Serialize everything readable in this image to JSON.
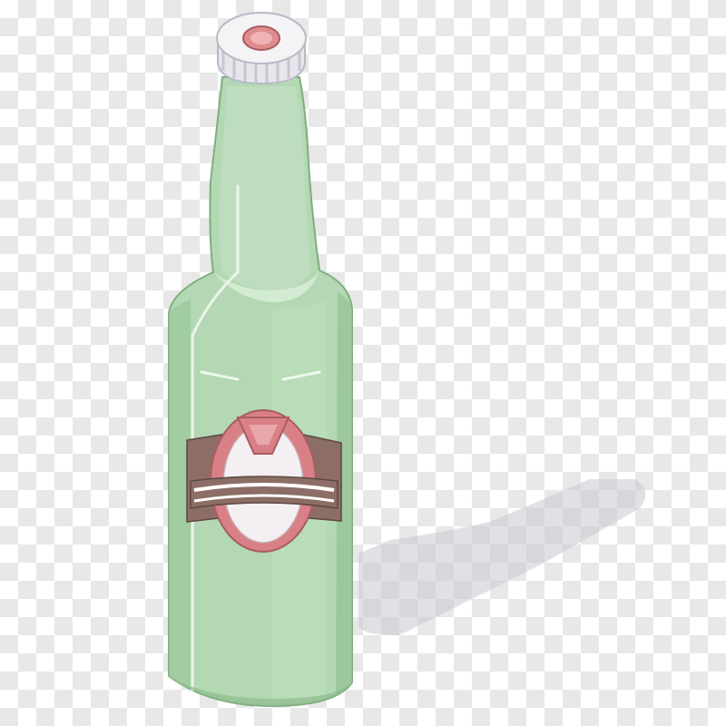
{
  "image": {
    "background": "transparency-checkerboard",
    "subject": "bottle-icon"
  },
  "colors": {
    "glass_light": "#cfe6cf",
    "glass_mid": "#a9d1a9",
    "glass_dark": "#86b886",
    "glass_outline": "#7fae7f",
    "cap_white": "#f4f4f6",
    "cap_ring": "#d8d8e0",
    "cap_dot": "#e08c8f",
    "label_band": "#8c6e66",
    "label_oval_fill": "#f3eff2",
    "label_oval_stroke": "#d97f86",
    "label_ribbon": "#d97f86",
    "shadow": "#c9c9cf"
  }
}
